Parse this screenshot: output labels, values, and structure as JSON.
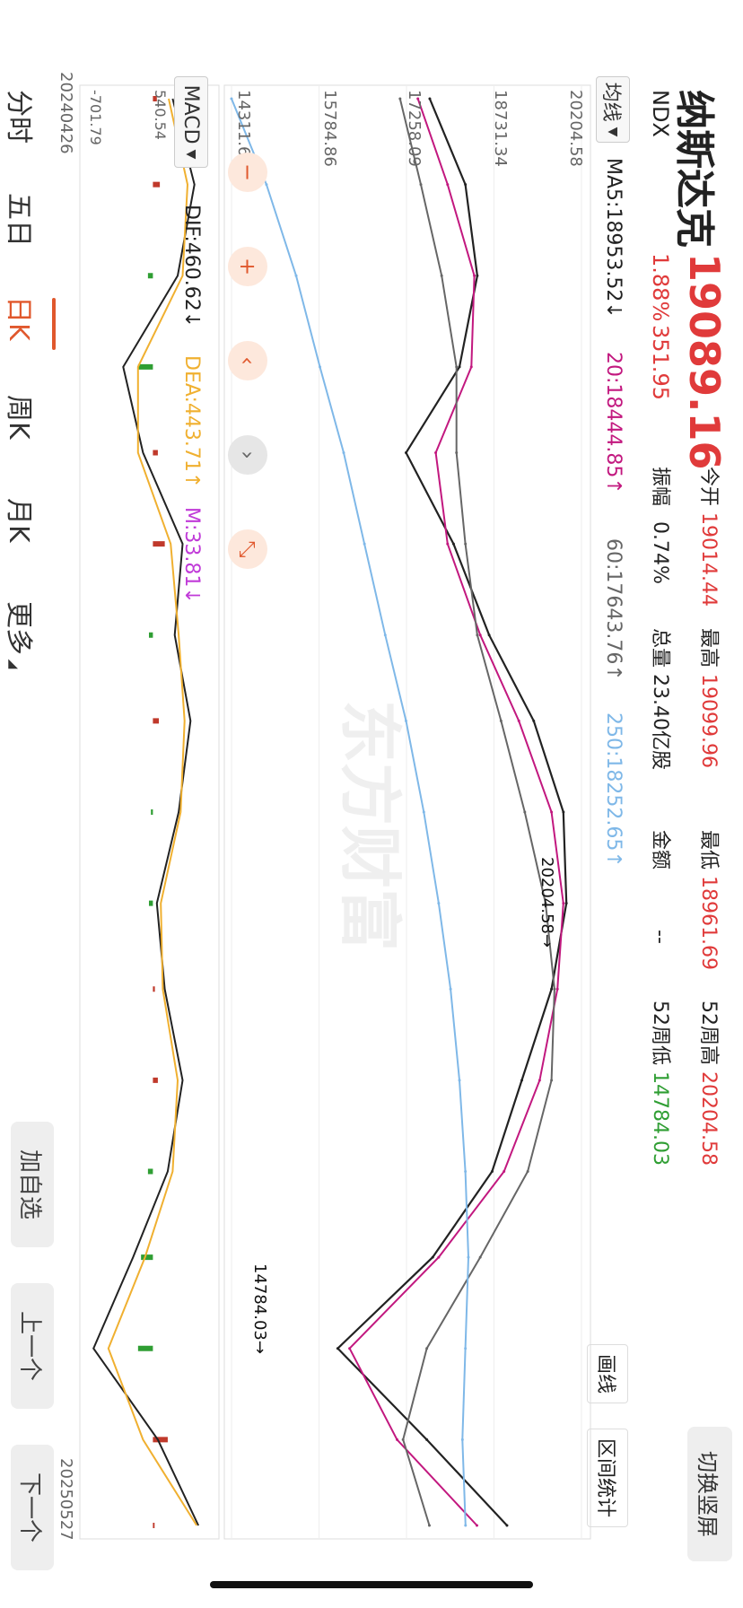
{
  "header": {
    "title": "纳斯达克",
    "code": "NDX",
    "price": "19089.16",
    "change_pct": "1.88%",
    "change_abs": "351.95",
    "stats": {
      "open_label": "今开",
      "open_value": "19014.44",
      "amp_label": "振幅",
      "amp_value": "0.74%",
      "high_label": "最高",
      "high_value": "19099.96",
      "vol_label": "总量",
      "vol_value": "23.40亿股",
      "low_label": "最低",
      "low_value": "18961.69",
      "amt_label": "金额",
      "amt_value": "--",
      "w52h_label": "52周高",
      "w52h_value": "20204.58",
      "w52l_label": "52周低",
      "w52l_value": "14784.03"
    },
    "switch_button": "切换竖屏"
  },
  "ma_bar": {
    "selector": "均线",
    "ma5": "MA5:18953.52↓",
    "ma20": "20:18444.85↑",
    "ma60": "60:17643.76↑",
    "ma250": "250:18252.65↑"
  },
  "tools": {
    "draw": "画线",
    "interval": "区间统计"
  },
  "macd_bar": {
    "selector": "MACD",
    "dif": "DIF:460.62↓",
    "dea": "DEA:443.71↑",
    "m": "M:33.81↓"
  },
  "controls": {
    "minus": "−",
    "plus": "+",
    "left": "‹",
    "right": "›",
    "collapse": "⤡"
  },
  "watermark": "东方财富",
  "tabs": [
    {
      "label": "分时"
    },
    {
      "label": "五日"
    },
    {
      "label": "日K"
    },
    {
      "label": "周K"
    },
    {
      "label": "月K"
    },
    {
      "label": "更多"
    }
  ],
  "side_buttons": {
    "add": "加自选",
    "prev": "上一个",
    "next": "下一个"
  },
  "chart_data": {
    "type": "line",
    "title": "",
    "x_start_label": "20240426",
    "x_end_label": "20250527",
    "price_axis_labels": [
      "20204.58",
      "18731.34",
      "17258.09",
      "15784.86",
      "14311.60"
    ],
    "ylim": [
      14311.6,
      20204.58
    ],
    "max_annotation": "20204.58",
    "min_annotation": "14784.03",
    "x": [
      0,
      16,
      33,
      50,
      66,
      83,
      100,
      116,
      133,
      150,
      166,
      183,
      200,
      216,
      233,
      250,
      266
    ],
    "series": [
      {
        "name": "MA5",
        "color": "#222222",
        "values": [
          17650,
          18250,
          18450,
          18150,
          17250,
          18050,
          18650,
          19400,
          19900,
          19950,
          19700,
          19200,
          18700,
          17700,
          16100,
          17600,
          18950
        ]
      },
      {
        "name": "20",
        "color": "#c2187f",
        "values": [
          17450,
          17950,
          18400,
          18350,
          17750,
          17950,
          18500,
          19150,
          19700,
          19900,
          19800,
          19500,
          18900,
          17800,
          16300,
          17100,
          18444
        ]
      },
      {
        "name": "60",
        "color": "#666666",
        "values": [
          17150,
          17500,
          17850,
          18100,
          18100,
          18250,
          18450,
          18850,
          19250,
          19600,
          19750,
          19700,
          19300,
          18500,
          17600,
          17200,
          17643
        ]
      },
      {
        "name": "250",
        "color": "#7fb8e8",
        "values": [
          14311,
          14900,
          15400,
          15800,
          16200,
          16550,
          16900,
          17250,
          17550,
          17800,
          18000,
          18150,
          18250,
          18300,
          18250,
          18200,
          18252
        ]
      }
    ],
    "macd_axis_labels": [
      "540.54",
      "-701.79"
    ],
    "macd_ylim": [
      -701.79,
      540.54
    ],
    "macd": {
      "dif": [
        200,
        420,
        250,
        -300,
        -100,
        300,
        220,
        380,
        260,
        40,
        120,
        300,
        150,
        -200,
        -600,
        50,
        460
      ],
      "dea": [
        160,
        350,
        300,
        -150,
        -150,
        180,
        260,
        320,
        280,
        80,
        100,
        250,
        200,
        -80,
        -450,
        -100,
        443
      ],
      "hist": [
        40,
        70,
        -50,
        -150,
        50,
        120,
        -40,
        60,
        -20,
        -40,
        20,
        50,
        -50,
        -120,
        -150,
        150,
        17
      ]
    }
  }
}
